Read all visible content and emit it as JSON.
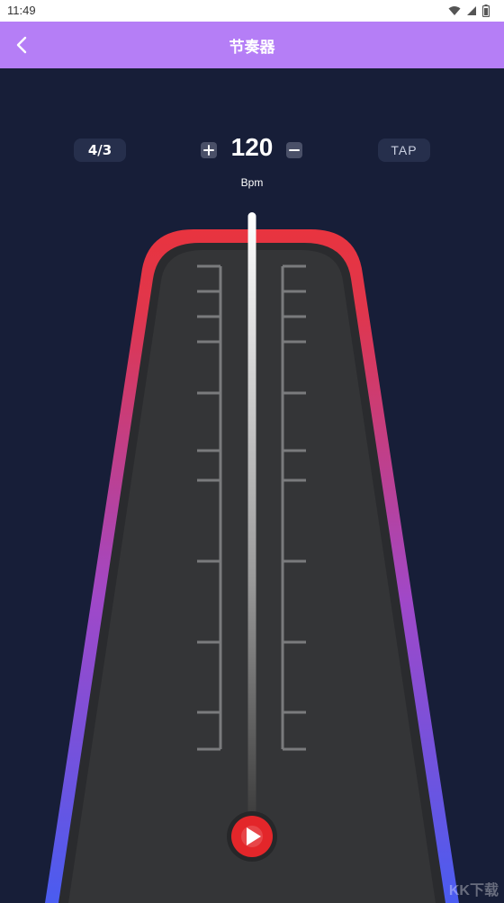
{
  "status_bar": {
    "time": "11:49",
    "icons": [
      "wifi-icon",
      "signal-icon",
      "battery-icon"
    ]
  },
  "app_bar": {
    "title": "节奏器",
    "back_icon": "chevron-left-icon"
  },
  "controls": {
    "time_signature": "4/3",
    "bpm": "120",
    "bpm_unit": "Bpm",
    "tap_label": "TAP",
    "plus_icon": "plus-icon",
    "minus_icon": "minus-icon"
  },
  "metronome": {
    "frame_gradient": [
      "#e8343f",
      "#a048c8",
      "#4a5cf0"
    ],
    "body_color": "#2d2e2f",
    "play_icon": "play-icon",
    "play_color": "#e3262a"
  },
  "watermark": "KK下载"
}
